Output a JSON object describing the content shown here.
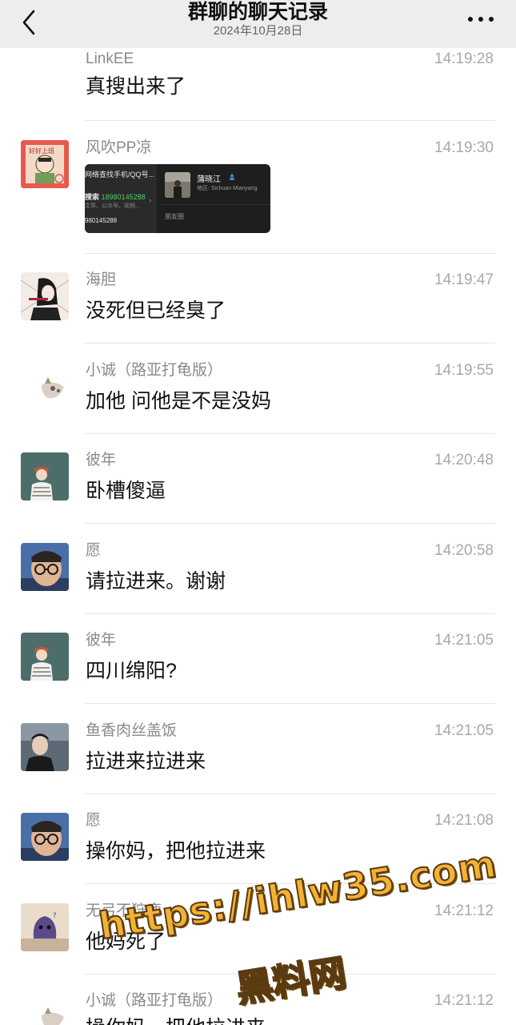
{
  "header": {
    "title": "群聊的聊天记录",
    "date": "2024年10月28日"
  },
  "messages": [
    {
      "sender": "LinkEE",
      "time": "14:19:28",
      "text": "真搜出来了"
    },
    {
      "sender": "风吹PP凉",
      "time": "14:19:30",
      "text": "",
      "card": {
        "left_title": "网络查找手机/QQ号...",
        "search_label": "搜索",
        "search_number": "18980145288",
        "left_sub": "文章、公众号、视频...",
        "left_num": "980145288",
        "name": "蒲晓江",
        "region": "地区: Sichuan Mianyang",
        "moments": "朋友圈"
      }
    },
    {
      "sender": "海胆",
      "time": "14:19:47",
      "text": "没死但已经臭了"
    },
    {
      "sender": "小诚（路亚打龟版）",
      "time": "14:19:55",
      "text": "加他 问他是不是没妈"
    },
    {
      "sender": "彼年",
      "time": "14:20:48",
      "text": "卧槽傻逼"
    },
    {
      "sender": "愿",
      "time": "14:20:58",
      "text": "请拉进来。谢谢"
    },
    {
      "sender": "彼年",
      "time": "14:21:05",
      "text": "四川绵阳?"
    },
    {
      "sender": "鱼香肉丝盖饭",
      "time": "14:21:05",
      "text": "拉进来拉进来"
    },
    {
      "sender": "愿",
      "time": "14:21:08",
      "text": "操你妈，把他拉进来"
    },
    {
      "sender": "无弓不狩鹿",
      "time": "14:21:12",
      "text": "他妈死了"
    },
    {
      "sender": "小诚（路亚打龟版）",
      "time": "14:21:12",
      "text": "操你妈，把他拉进来"
    }
  ],
  "watermark": {
    "url": "https://ihlw35.com",
    "name": "黑料网"
  },
  "icons": {
    "back": "chevron-left-icon",
    "more": "more-dots-icon"
  }
}
